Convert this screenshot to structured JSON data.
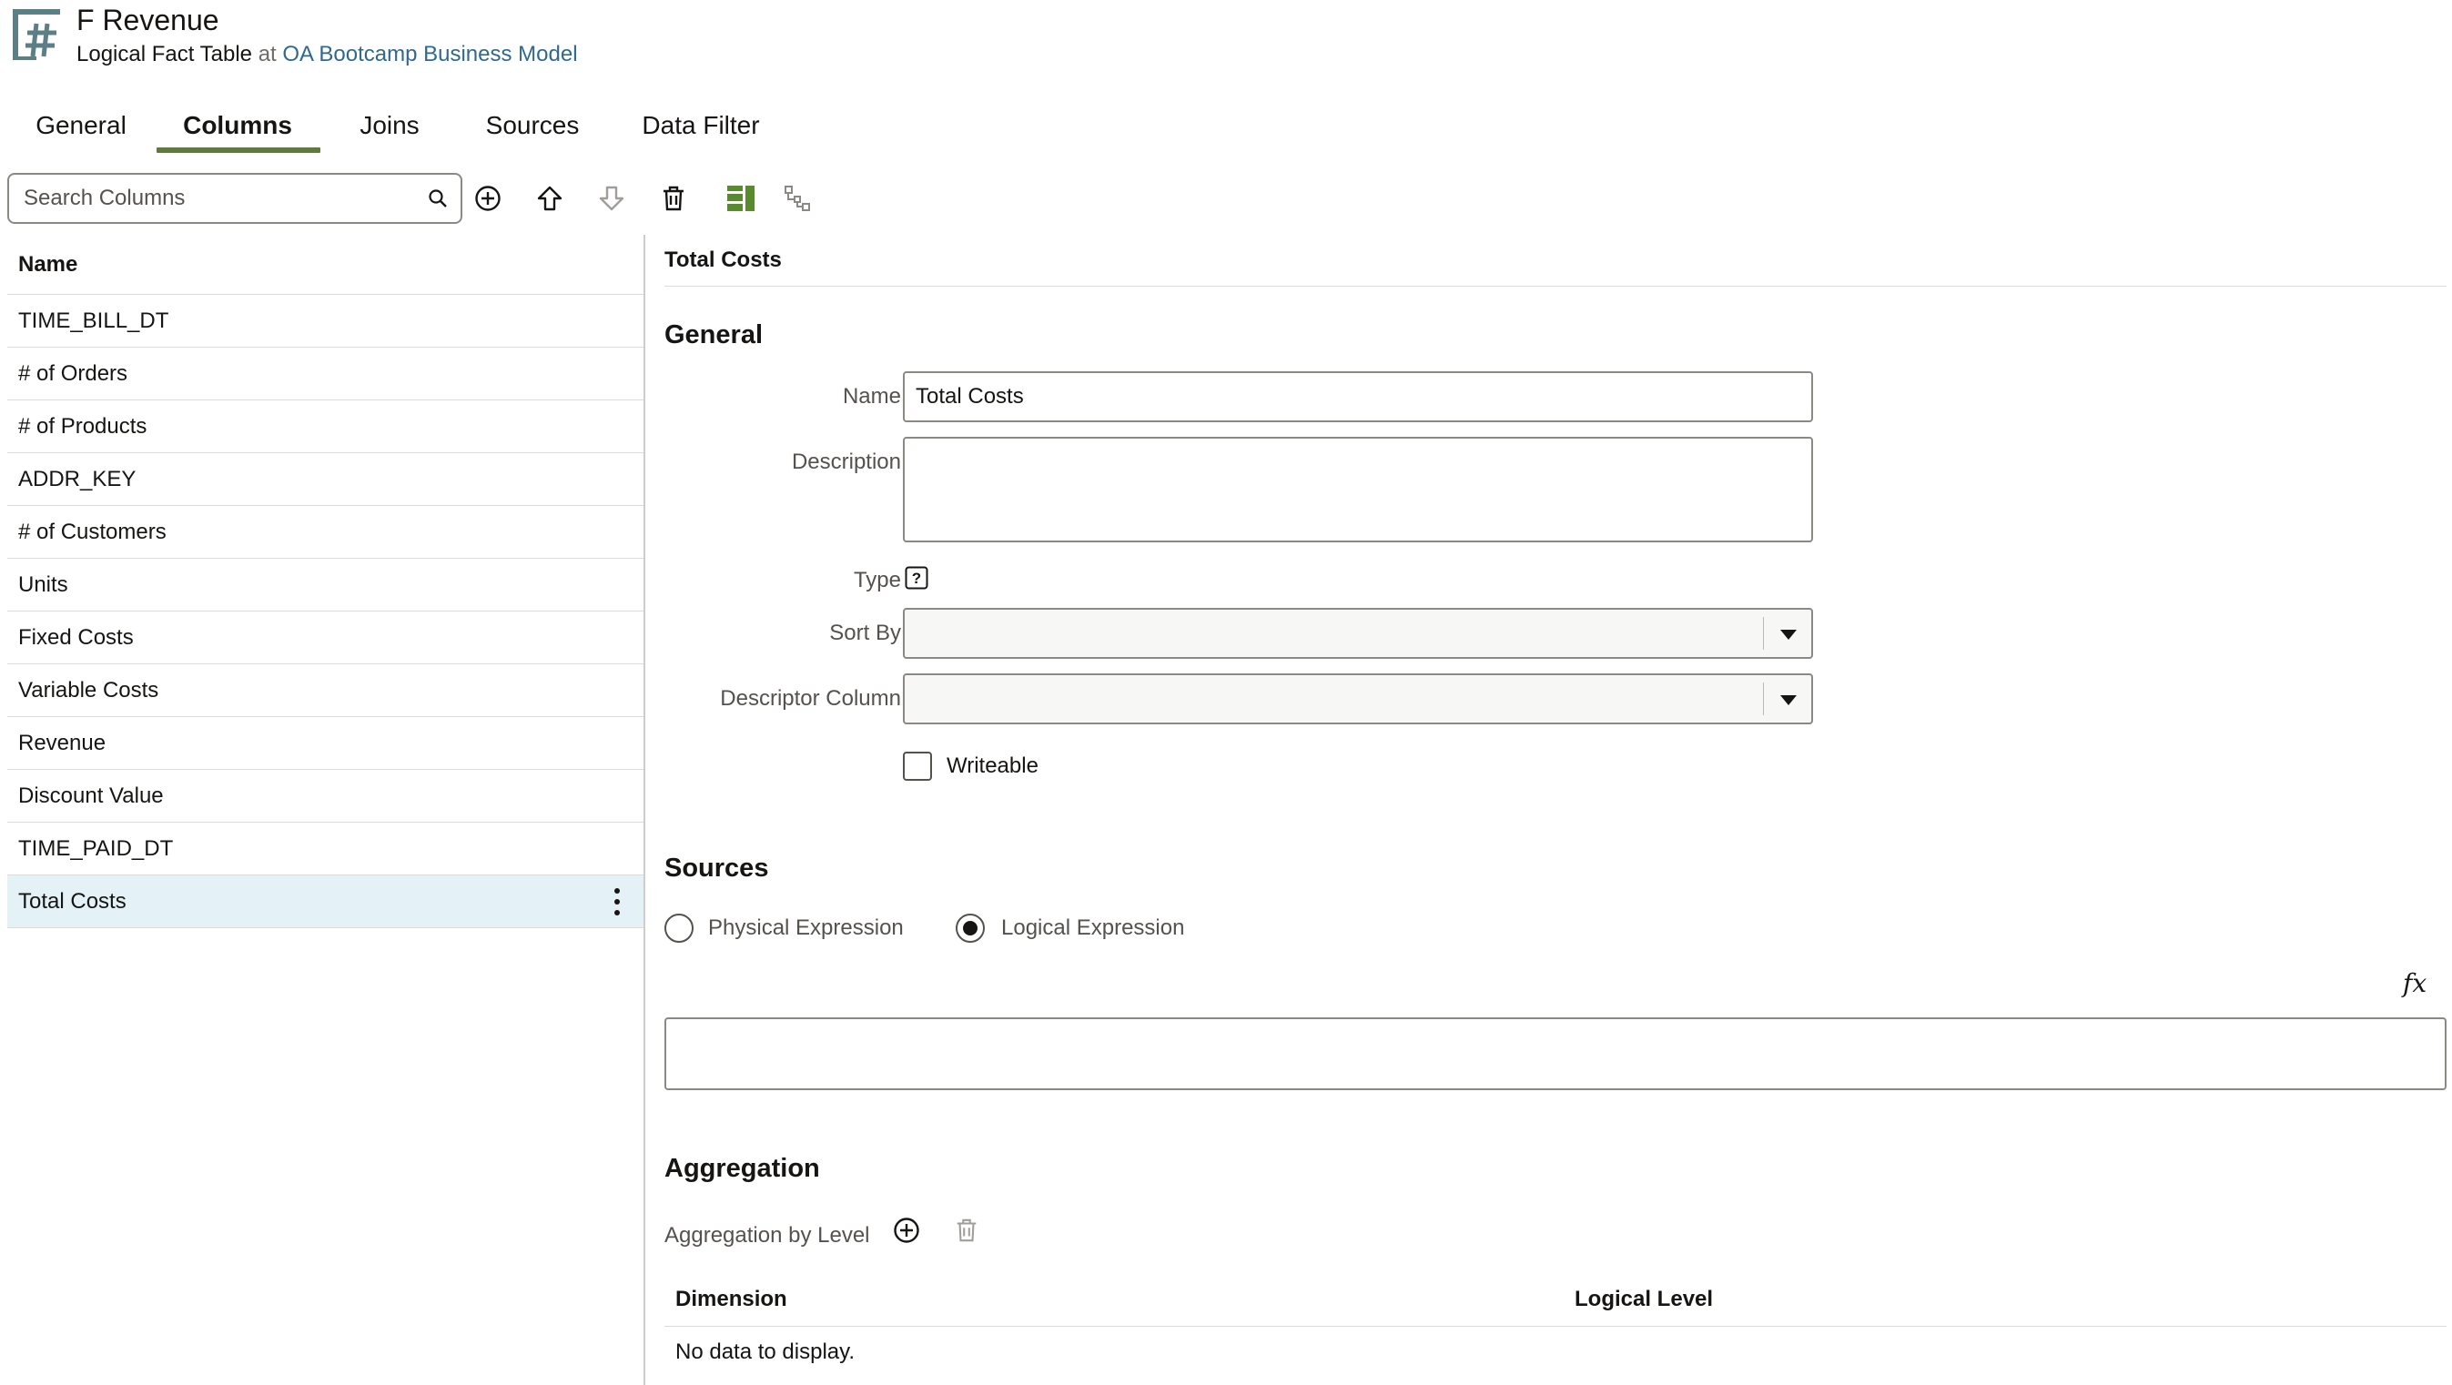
{
  "header": {
    "title": "F Revenue",
    "subtitle_type": "Logical Fact Table",
    "subtitle_at": "at",
    "subtitle_link": "OA Bootcamp Business Model",
    "icon": "fact-table-icon"
  },
  "tabs": [
    {
      "label": "General"
    },
    {
      "label": "Columns",
      "active": true
    },
    {
      "label": "Joins"
    },
    {
      "label": "Sources"
    },
    {
      "label": "Data Filter"
    }
  ],
  "toolbar": {
    "search_placeholder": "Search Columns",
    "icons": [
      "add-icon",
      "move-up-icon",
      "move-down-icon",
      "delete-icon",
      "layout-icon",
      "hierarchy-icon"
    ]
  },
  "columns_list": {
    "header": "Name",
    "items": [
      "TIME_BILL_DT",
      "# of Orders",
      "# of Products",
      "ADDR_KEY",
      "# of Customers",
      "Units",
      "Fixed Costs",
      "Variable Costs",
      "Revenue",
      "Discount Value",
      "TIME_PAID_DT",
      "Total Costs"
    ],
    "selected": "Total Costs"
  },
  "detail": {
    "title": "Total Costs",
    "general": {
      "heading": "General",
      "name_label": "Name",
      "name_value": "Total Costs",
      "description_label": "Description",
      "description_value": "",
      "type_label": "Type",
      "sort_by_label": "Sort By",
      "sort_by_value": "",
      "descriptor_label": "Descriptor Column",
      "descriptor_value": "",
      "writeable_label": "Writeable",
      "writeable_checked": false
    },
    "sources": {
      "heading": "Sources",
      "physical_label": "Physical Expression",
      "logical_label": "Logical Expression",
      "selected": "Logical Expression",
      "fx_label": "fx",
      "expression_value": ""
    },
    "aggregation": {
      "heading": "Aggregation",
      "by_level_label": "Aggregation by Level",
      "col_dimension": "Dimension",
      "col_logical_level": "Logical Level",
      "empty_text": "No data to display."
    }
  },
  "colors": {
    "accent_underline": "#5e7a3c",
    "link": "#2f6a8e",
    "selected_row": "#e4f1f7",
    "layout_icon": "#5a8a2e"
  }
}
